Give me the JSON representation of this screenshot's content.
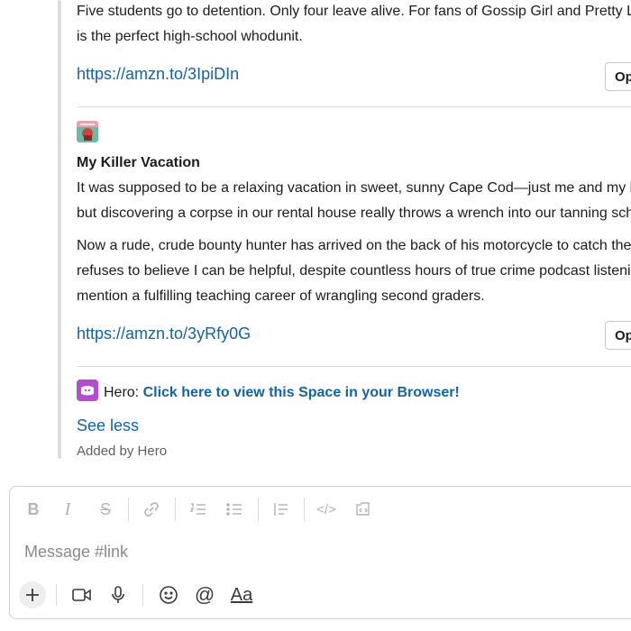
{
  "feed": {
    "item1": {
      "description_line1": "Five students go to detention. Only four leave alive. For fans of Gossip Girl and Pretty L",
      "description_line2": "is the perfect high-school whodunit.",
      "link": "https://amzn.to/3IpiDIn",
      "open_label": "Op"
    },
    "item2": {
      "title": "My Killer Vacation",
      "para1_line1": "It was supposed to be a relaxing vacation in sweet, sunny Cape Cod—just me and my be",
      "para1_line2": "but discovering a corpse in our rental house really throws a wrench into our tanning sch",
      "para2_line1": "Now a rude, crude bounty hunter has arrived on the back of his motorcycle to catch the",
      "para2_line2": "refuses to believe I can be helpful, despite countless hours of true crime podcast listeni",
      "para2_line3": "mention a fulfilling teaching career of wrangling second graders.",
      "link": "https://amzn.to/3yRfy0G",
      "open_label": "Op"
    },
    "hero": {
      "prefix": "Hero: ",
      "link_text": "Click here to view this Space in your Browser!"
    },
    "see_less": "See less",
    "added_by": "Added by Hero"
  },
  "composer": {
    "placeholder": "Message #link",
    "formatting_icons": [
      "bold-icon",
      "italic-icon",
      "strikethrough-icon",
      "link-icon",
      "numbered-list-icon",
      "bulleted-list-icon",
      "blockquote-icon",
      "code-icon",
      "code-block-icon"
    ],
    "action_icons": [
      "plus-icon",
      "video-icon",
      "microphone-icon",
      "emoji-icon",
      "mention-icon",
      "text-format-icon"
    ]
  },
  "colors": {
    "link": "#1264a3",
    "hero_brand": "#b14ec9",
    "text": "#1d1c1d",
    "muted": "#616061"
  }
}
